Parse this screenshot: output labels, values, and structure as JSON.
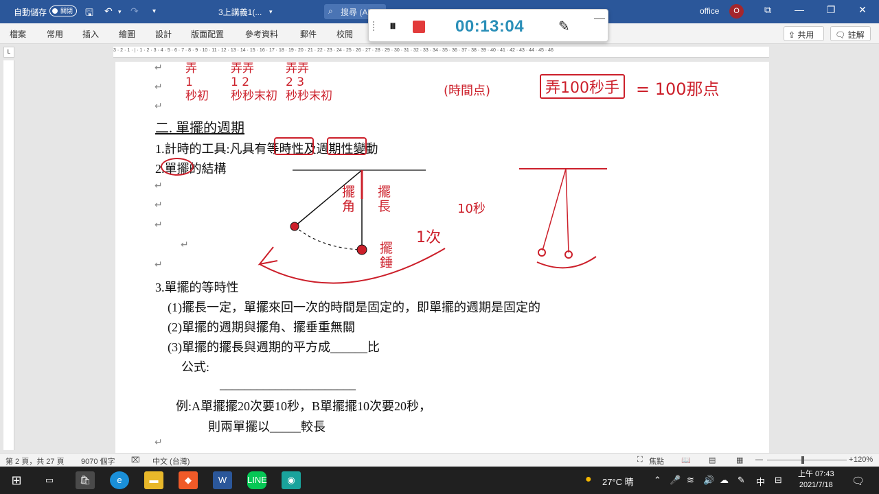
{
  "titlebar": {
    "autosave_label": "自動儲存",
    "autosave_state": "關閉",
    "doc_title": "3上講義1(...",
    "search_text": "搜尋 (Alt+Q)",
    "account_name": "office",
    "avatar_letter": "O"
  },
  "ribbon": {
    "tabs": [
      "檔案",
      "常用",
      "插入",
      "繪圖",
      "設計",
      "版面配置",
      "參考資料",
      "郵件",
      "校閱"
    ],
    "share_label": "共用",
    "comment_label": "註解"
  },
  "recorder": {
    "elapsed": "00:13:04"
  },
  "ruler": {
    "corner": "L",
    "numbers": "3 · 2 · 1 · | · 1 · 2 · 3 · 4 · 5 · 6 · 7 · 8 · 9 · 10 · 11 · 12 · 13 · 14 · 15 · 16 · 17 · 18 · 19 · 20 · 21 · 22 · 23 · 24 · 25 · 26 · 27 · 28 · 29 · 30 · 31 · 32 · 33 · 34 · 35 · 36 · 37 · 38 · 39 · 40 · 41 · 42 · 43 · 44 · 45 · 46"
  },
  "document": {
    "heading": "二. 單擺的週期",
    "line1": "1.計時的工具:凡具有等時性及週期性變動",
    "line2": "2.單擺的結構",
    "line3": "3.單擺的等時性",
    "item1": "(1)擺長一定，單擺來回一次的時間是固定的，即單擺的週期是固定的",
    "item2": "(2)單擺的週期與擺角、擺垂重無關",
    "item3": "(3)單擺的擺長與週期的平方成______比",
    "formula_label": "公式:",
    "formula_blank": "______________________",
    "example": "例:A單擺擺20次要10秒，B單擺擺10次要20秒，",
    "example2": "則兩單擺以_____較長"
  },
  "ink": {
    "col1": "秒初",
    "col2": "秒秒末初",
    "col3": "秒秒末初",
    "right_top": "(時間点)",
    "boxed": "弄100秒手",
    "equals": "= 100那点",
    "label_angle": "擺角",
    "label_length": "擺長",
    "label_bob": "擺錘",
    "label_once": "1次",
    "label_10s": "10秒"
  },
  "statusbar": {
    "page": "第 2 頁，共 27 頁",
    "words": "9070 個字",
    "language": "中文 (台灣)",
    "focus": "焦點",
    "zoom": "120%"
  },
  "taskbar": {
    "weather": "27°C 晴",
    "ime": "中",
    "time": "上午 07:43",
    "date": "2021/7/18"
  },
  "colors": {
    "word_blue": "#2b579a",
    "ink_red": "#cc1f2a",
    "recorder_time": "#2a8fb8"
  }
}
